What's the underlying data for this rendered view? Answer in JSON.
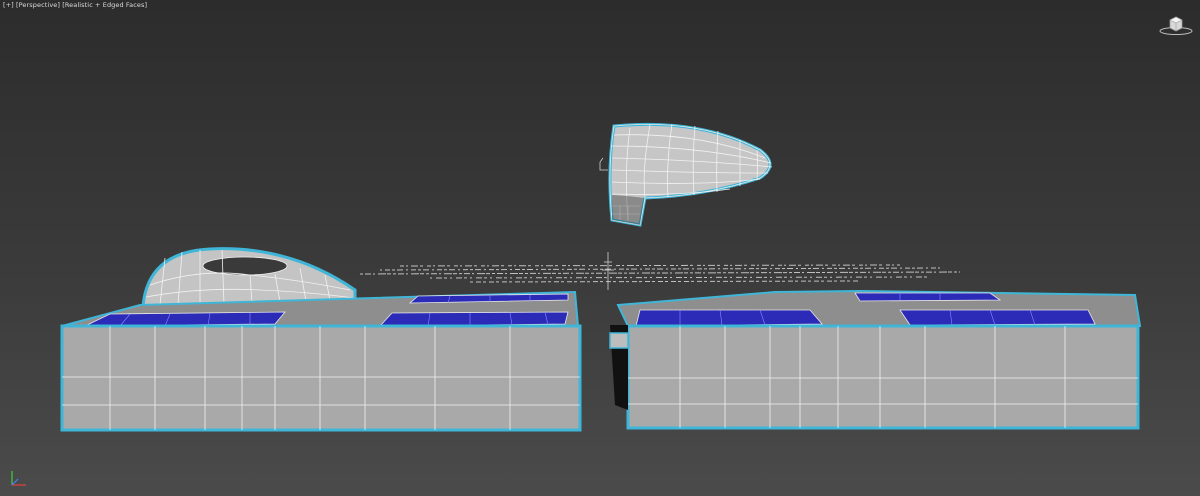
{
  "viewport": {
    "labels": {
      "menu": "[+]",
      "view": "[Perspective]",
      "shading": "[Realistic + Edged Faces]"
    },
    "colors": {
      "background_top": "#2c2c2c",
      "background_bottom": "#4b4b4b",
      "selection_outline": "#3fb6d8",
      "wire": "#f2f2f2",
      "body_face": "#a9a9a9",
      "panel": "#2b2bb8"
    }
  },
  "icons": {
    "viewcube": "viewcube-icon",
    "world_axis": "world-axis-icon",
    "pivot": "pivot-gizmo-icon"
  }
}
